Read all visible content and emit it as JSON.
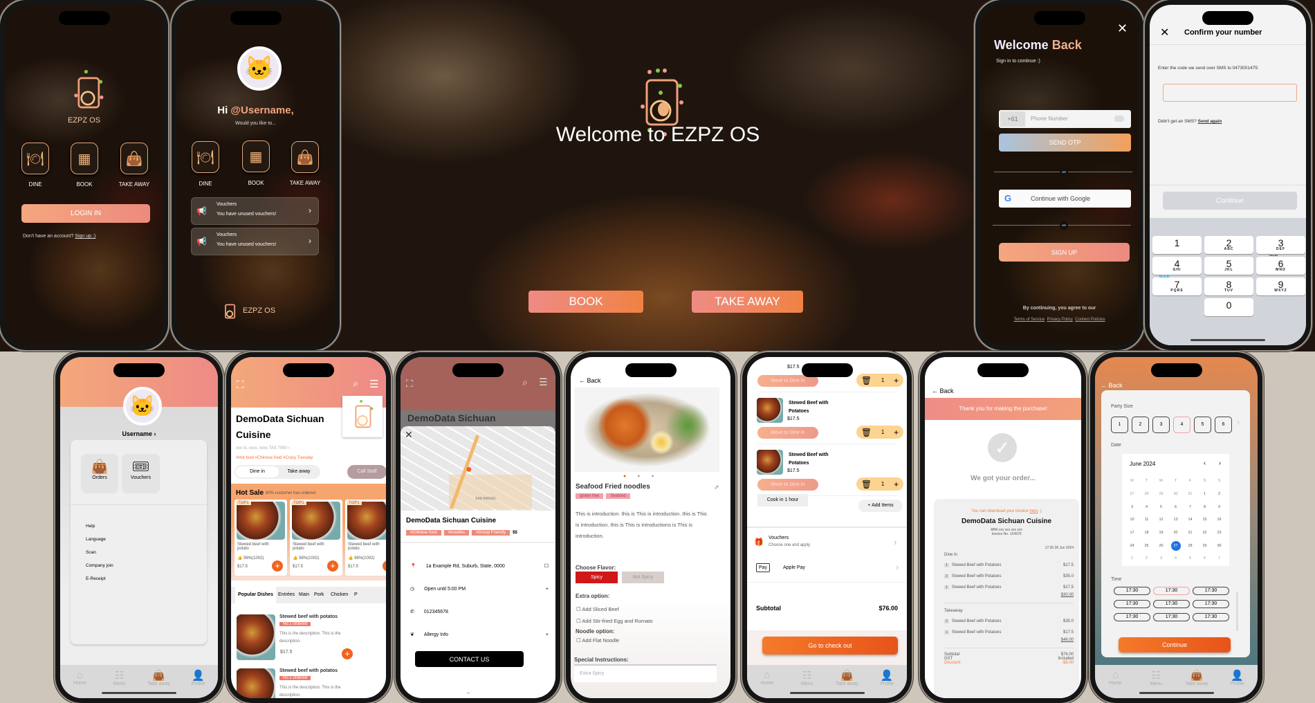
{
  "colors": {
    "accent": "#f08a7c",
    "orange": "#f0641e",
    "selected_date": "#1e73e8",
    "background": "#cec6ba"
  },
  "tabbar": [
    "Home",
    "Menu",
    "Take away",
    "Profile"
  ],
  "login_screen": {
    "brand": "EZPZ OS",
    "options": [
      "DINE",
      "BOOK",
      "TAKE AWAY"
    ],
    "login_button": "LOGIN IN",
    "signup_prompt": "Don't have an account?",
    "signup_link": "Sign up :)"
  },
  "home_screen": {
    "hi": "Hi",
    "username": "@Username,",
    "subtitle": "Would you like to...",
    "options": [
      "DINE",
      "BOOK",
      "TAKE AWAY"
    ],
    "vouchers": [
      {
        "title": "Vouchers",
        "text": "You have unused vouchers!"
      },
      {
        "title": "Vouchers",
        "text": "You have unused vouchers!"
      }
    ],
    "brand": "EZPZ OS"
  },
  "hero": {
    "title": "Welcome to EZPZ OS",
    "book": "BOOK",
    "take_away": "TAKE AWAY"
  },
  "signin": {
    "title_a": "Welcome",
    "title_b": "Back",
    "subtitle": "Sign in to continue :)",
    "country_code": "+61",
    "phone_placeholder": "Phone Number",
    "send_otp": "SEND OTP",
    "or": "OR",
    "google": "Continue with Google",
    "sign_up": "SIGN UP",
    "agree": "By continuing, you agree to our",
    "links": [
      "Terms of Service",
      "Privacy Policy",
      "Content Policies"
    ]
  },
  "confirm": {
    "title": "Confirm your number",
    "instruction": "Enter the code we send over SMS to 0473001475:",
    "resend_prompt": "Didn't get an SMS?",
    "resend_link": "Send again",
    "continue": "Continue",
    "keys": [
      {
        "n": "1",
        "l": ""
      },
      {
        "n": "2",
        "l": "ABC"
      },
      {
        "n": "3",
        "l": "DEF"
      },
      {
        "n": "4",
        "l": "GHI"
      },
      {
        "n": "5",
        "l": "JKL"
      },
      {
        "n": "6",
        "l": "MNO"
      },
      {
        "n": "7",
        "l": "PQRS"
      },
      {
        "n": "8",
        "l": "TUV"
      },
      {
        "n": "9",
        "l": "WXYZ"
      },
      {
        "n": "0",
        "l": ""
      }
    ]
  },
  "profile": {
    "username": "Username",
    "tiles": [
      "Orders",
      "Vouchers"
    ],
    "menu": [
      "Help",
      "Language",
      "Scan",
      "Company join",
      "E-Receipt"
    ]
  },
  "menu": {
    "restaurant": "DemoData Sichuan Cuisine",
    "address": "xxx st, xxxx, xxxx TAS 7050",
    "tags": "#Hot food  #Chinese food #Crazy Tuesday",
    "modes": [
      "Dine in",
      "Take away"
    ],
    "call_staff": "Call Staff",
    "hot_sale": "Hot Sale",
    "hot_sale_note": "80% customer has ordered",
    "hot_items": [
      {
        "badge": "TOP1",
        "name": "Stewed beef with potato",
        "rating": "98%(1002)",
        "price": "$17.5"
      },
      {
        "badge": "TOP1",
        "name": "Stewed beef with potato",
        "rating": "98%(1002)",
        "price": "$17.5"
      },
      {
        "badge": "TOP1",
        "name": "Stewed beef with potato",
        "rating": "98%(1002)",
        "price": "$17.5"
      }
    ],
    "categories": [
      "Popular Dishes",
      "Entrées",
      "Main",
      "Pork",
      "Chicken",
      "P"
    ],
    "dishes": [
      {
        "name": "Stewed beef with potatos",
        "badge": "No.1 ordered",
        "desc": "This is the description. This is the description.",
        "price": "$17.5"
      },
      {
        "name": "Stewed beef with potatos",
        "badge": "No.1 ordered",
        "desc": "This is the description. This is the description.",
        "price": ""
      }
    ]
  },
  "map_sheet": {
    "header_title": "DemoData Sichuan",
    "name": "DemoData Sichuan Cuisine",
    "tags": [
      "#Chinese food",
      "#noodles",
      "#Group Friendly"
    ],
    "price_level": "$$",
    "map_label": "SAN RAFAEL",
    "address": "1a Example Rd, Suburb, State, 0000",
    "hours": "Open until 5:00 PM",
    "phone": "012345678",
    "allergy": "Allergy Info",
    "contact": "CONTACT US"
  },
  "dish": {
    "back": "Back",
    "title": "Seafood Fried noodles",
    "tags": [
      "gluten free",
      "Seafood"
    ],
    "intro": "This is introduction. this is This is introduction. this is This is introduction. this is This is introductions is This is introduction.",
    "flavor_label": "Choose Flavor:",
    "flavors": [
      "Spicy",
      "Not Spicy"
    ],
    "extra_label": "Extra option:",
    "extras": [
      "Add Sliced Beef",
      "Add Stir-fried Egg and Romato"
    ],
    "noodle_label": "Noodle option:",
    "noodles": [
      "Add Flat Noodle"
    ],
    "special_label": "Special Instructions:",
    "special_placeholder": "Extra Spicy"
  },
  "cart": {
    "items": [
      {
        "name": "Stewed Beef with Potatoes",
        "price": "$17.5",
        "qty": "1"
      },
      {
        "name": "Stewed Beef with Potatoes",
        "price": "$17.5",
        "qty": "1"
      },
      {
        "name": "Stewed Beef with Potatoes",
        "price": "$17.5",
        "qty": "1"
      }
    ],
    "move_label": "Move to Dine in",
    "cook_time": "Cook in 1 hour",
    "add_items": "Add Items",
    "vouchers_title": "Vouchers",
    "vouchers_sub": "Choose one and apply",
    "apple_pay_badge": "Pay",
    "apple_pay": "Apple Pay",
    "subtotal_label": "Subtotal",
    "subtotal": "$76.00",
    "checkout": "Go to check out"
  },
  "receipt": {
    "back": "Back",
    "banner": "Thank you for making the purchase!",
    "status": "We got your order...",
    "download_a": "You can download your invoice",
    "download_link": "here",
    "download_b": ":)",
    "name": "DemoData Sichuan Cuisine",
    "abn": "ABN xxx xxx xxx xxx",
    "invoice_no": "Invoice No. 124979",
    "datetime": "17:30 28 Jun 2024",
    "dine_in_label": "Dine In",
    "dine_in": [
      {
        "q": "1",
        "name": "Stewed Beef with Potatoes",
        "price": "$17.5"
      },
      {
        "q": "2",
        "name": "Stewed Beef with Potatoes",
        "price": "$35.0"
      },
      {
        "q": "1",
        "name": "Stewed Beef with Potatoes",
        "price": "$17.5"
      }
    ],
    "dine_in_total": "$30.00",
    "takeaway_label": "Takeaway",
    "takeaway": [
      {
        "q": "2",
        "name": "Stewed Beef with Potatoes",
        "price": "$35.0"
      },
      {
        "q": "1",
        "name": "Stewed Beef with Potatoes",
        "price": "$17.5"
      }
    ],
    "takeaway_total": "$46.00",
    "subtotal_label": "Subtotal",
    "subtotal": "$76.00",
    "gst_label": "GST",
    "gst": "Included",
    "discount_label": "Discount",
    "discount": "-$8.00"
  },
  "booking": {
    "back": "Back",
    "party_label": "Party Size",
    "party_sizes": [
      "1",
      "2",
      "3",
      "4",
      "5",
      "6"
    ],
    "party_selected": "4",
    "date_label": "Date",
    "month": "June 2024",
    "weekdays": [
      "M",
      "T",
      "W",
      "T",
      "F",
      "S",
      "S"
    ],
    "days": [
      "27",
      "28",
      "29",
      "30",
      "31",
      "1",
      "2",
      "3",
      "4",
      "5",
      "6",
      "7",
      "8",
      "9",
      "10",
      "11",
      "12",
      "13",
      "14",
      "15",
      "16",
      "17",
      "18",
      "19",
      "20",
      "21",
      "22",
      "23",
      "24",
      "25",
      "26",
      "27",
      "28",
      "29",
      "30",
      "1",
      "2",
      "3",
      "4",
      "5",
      "6",
      "7"
    ],
    "selected_day_index": 31,
    "time_label": "Time",
    "times": [
      "17:30",
      "17:30",
      "17:30",
      "17:30",
      "17:30",
      "17:30",
      "17:30",
      "17:30",
      "17:30"
    ],
    "selected_time_index": 1,
    "continue": "Continue"
  }
}
